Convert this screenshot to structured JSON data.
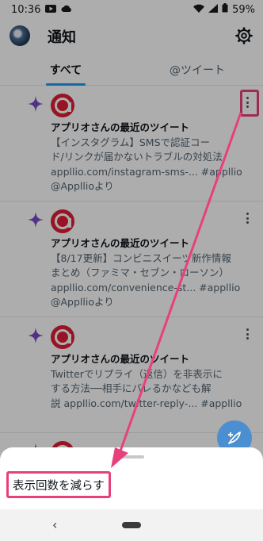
{
  "status_bar": {
    "time": "10:36",
    "battery": "59%"
  },
  "header": {
    "title": "通知"
  },
  "tabs": [
    {
      "label": "すべて",
      "active": true
    },
    {
      "label": "@ツイート",
      "active": false
    }
  ],
  "notifications": [
    {
      "headline": "アプリオさんの最近のツイート",
      "body_lines": [
        "【インスタグラム】SMSで認証コー",
        "ド/リンクが届かないトラブルの対処法",
        "appllio.com/instagram-sms-... #appllio"
      ],
      "via": "@Appllioより"
    },
    {
      "headline": "アプリオさんの最近のツイート",
      "body_lines": [
        "【8/17更新】コンビニスイーツ新作情報",
        "まとめ（ファミマ・セブン・ローソン）",
        "appllio.com/convenience-st... #appllio"
      ],
      "via": "@Appllioより"
    },
    {
      "headline": "アプリオさんの最近のツイート",
      "body_lines": [
        "Twitterでリプライ（返信）を非表示に",
        "する方法──相手にバレるかなども解",
        "説 appllio.com/twitter-reply-... #appllio"
      ],
      "via": ""
    }
  ],
  "bottom_sheet": {
    "option": "表示回数を減らす"
  },
  "colors": {
    "accent": "#1d9bf0",
    "highlight": "#e8407a",
    "brand_logo": "#e01e34",
    "sparkle": "#794bc4"
  }
}
